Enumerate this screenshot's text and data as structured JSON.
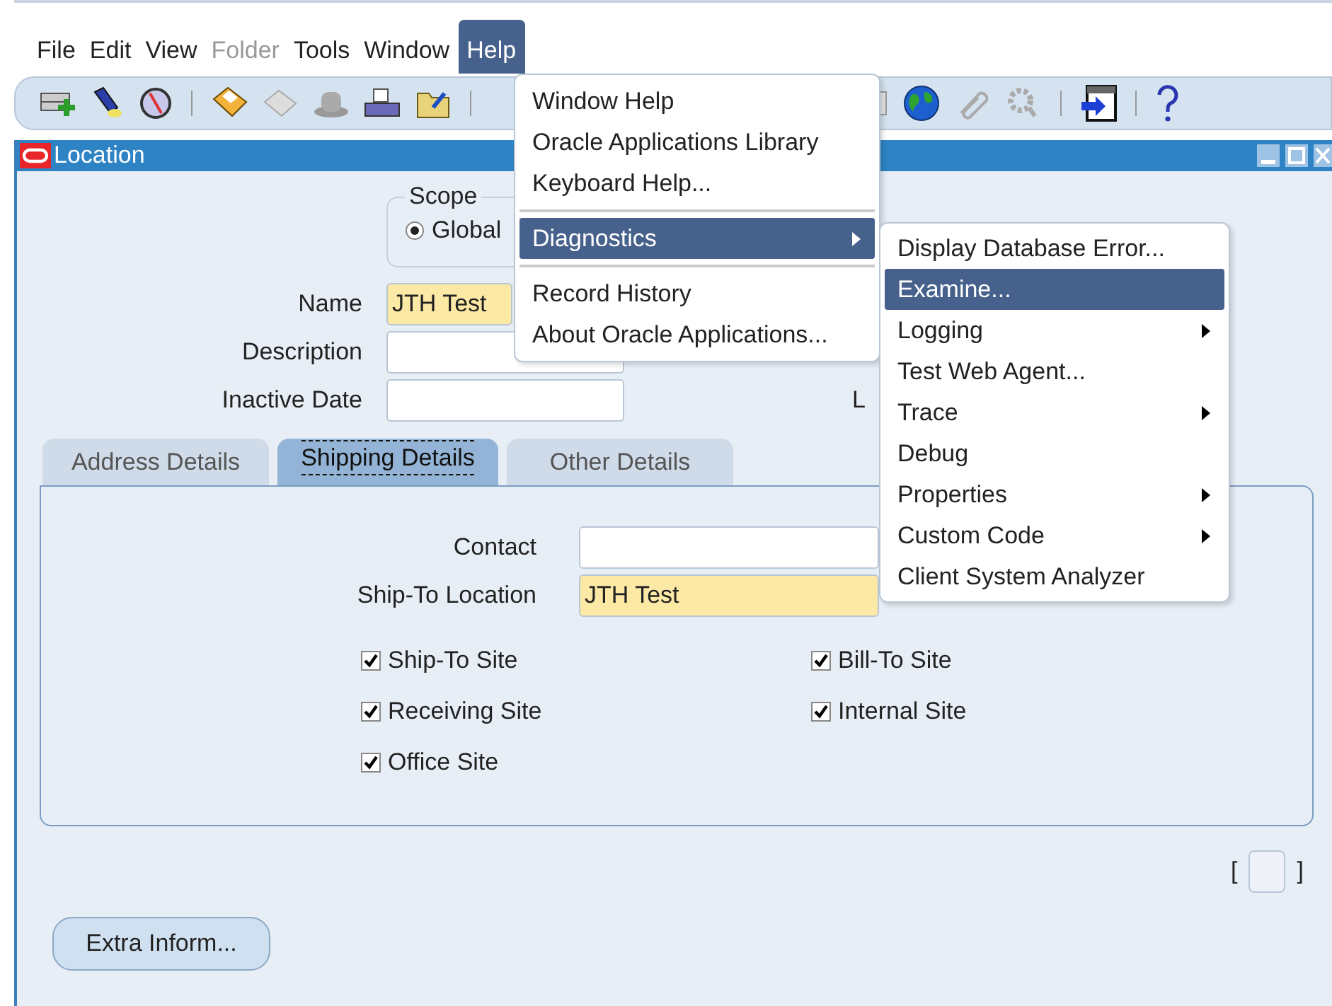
{
  "menu_bar": [
    {
      "label": "File",
      "selected": false,
      "disabled": false
    },
    {
      "label": "Edit",
      "selected": false,
      "disabled": false
    },
    {
      "label": "View",
      "selected": false,
      "disabled": false
    },
    {
      "label": "Folder",
      "selected": false,
      "disabled": true
    },
    {
      "label": "Tools",
      "selected": false,
      "disabled": false
    },
    {
      "label": "Window",
      "selected": false,
      "disabled": false
    },
    {
      "label": "Help",
      "selected": true,
      "disabled": false
    }
  ],
  "help_menu": [
    {
      "kind": "item",
      "label": "Window Help",
      "selected": false,
      "submenu": false
    },
    {
      "kind": "item",
      "label": "Oracle Applications Library",
      "selected": false,
      "submenu": false
    },
    {
      "kind": "item",
      "label": "Keyboard Help...",
      "selected": false,
      "submenu": false
    },
    {
      "kind": "separator"
    },
    {
      "kind": "item",
      "label": "Diagnostics",
      "selected": true,
      "submenu": true
    },
    {
      "kind": "separator"
    },
    {
      "kind": "item",
      "label": "Record History",
      "selected": false,
      "submenu": false
    },
    {
      "kind": "item",
      "label": "About Oracle Applications...",
      "selected": false,
      "submenu": false
    }
  ],
  "diagnostics_menu": [
    {
      "label": "Display Database Error...",
      "selected": false,
      "submenu": false
    },
    {
      "label": "Examine...",
      "selected": true,
      "submenu": false
    },
    {
      "label": "Logging",
      "selected": false,
      "submenu": true
    },
    {
      "label": "Test Web Agent...",
      "selected": false,
      "submenu": false
    },
    {
      "label": "Trace",
      "selected": false,
      "submenu": true
    },
    {
      "label": "Debug",
      "selected": false,
      "submenu": false
    },
    {
      "label": "Properties",
      "selected": false,
      "submenu": true
    },
    {
      "label": "Custom Code",
      "selected": false,
      "submenu": true
    },
    {
      "label": "Client System Analyzer",
      "selected": false,
      "submenu": false
    }
  ],
  "window": {
    "title": "Location"
  },
  "scope": {
    "title": "Scope",
    "options": [
      {
        "label": "Global",
        "selected": true
      }
    ]
  },
  "fields": [
    {
      "label": "Name",
      "value": "JTH Test",
      "required": true
    },
    {
      "label": "Description",
      "required": false
    },
    {
      "label": "Inactive Date",
      "required": false
    }
  ],
  "partial_label": "L",
  "tabs": [
    {
      "label": "Address Details",
      "selected": false
    },
    {
      "label": "Shipping Details",
      "selected": true
    },
    {
      "label": "Other Details",
      "selected": false
    }
  ],
  "shipping": {
    "fields": [
      {
        "label": "Contact",
        "required": false
      },
      {
        "label": "Ship-To Location",
        "value": "JTH Test",
        "required": true
      }
    ],
    "left_checkboxes": [
      {
        "label": "Ship-To Site",
        "checked": true
      },
      {
        "label": "Receiving Site",
        "checked": true
      },
      {
        "label": "Office Site",
        "checked": true
      }
    ],
    "right_checkboxes": [
      {
        "label": "Bill-To Site",
        "checked": true
      },
      {
        "label": "Internal Site",
        "checked": true
      }
    ]
  },
  "bracket": {
    "open": "[",
    "close": "]"
  },
  "buttons": [
    {
      "label": "Extra Inform..."
    }
  ]
}
